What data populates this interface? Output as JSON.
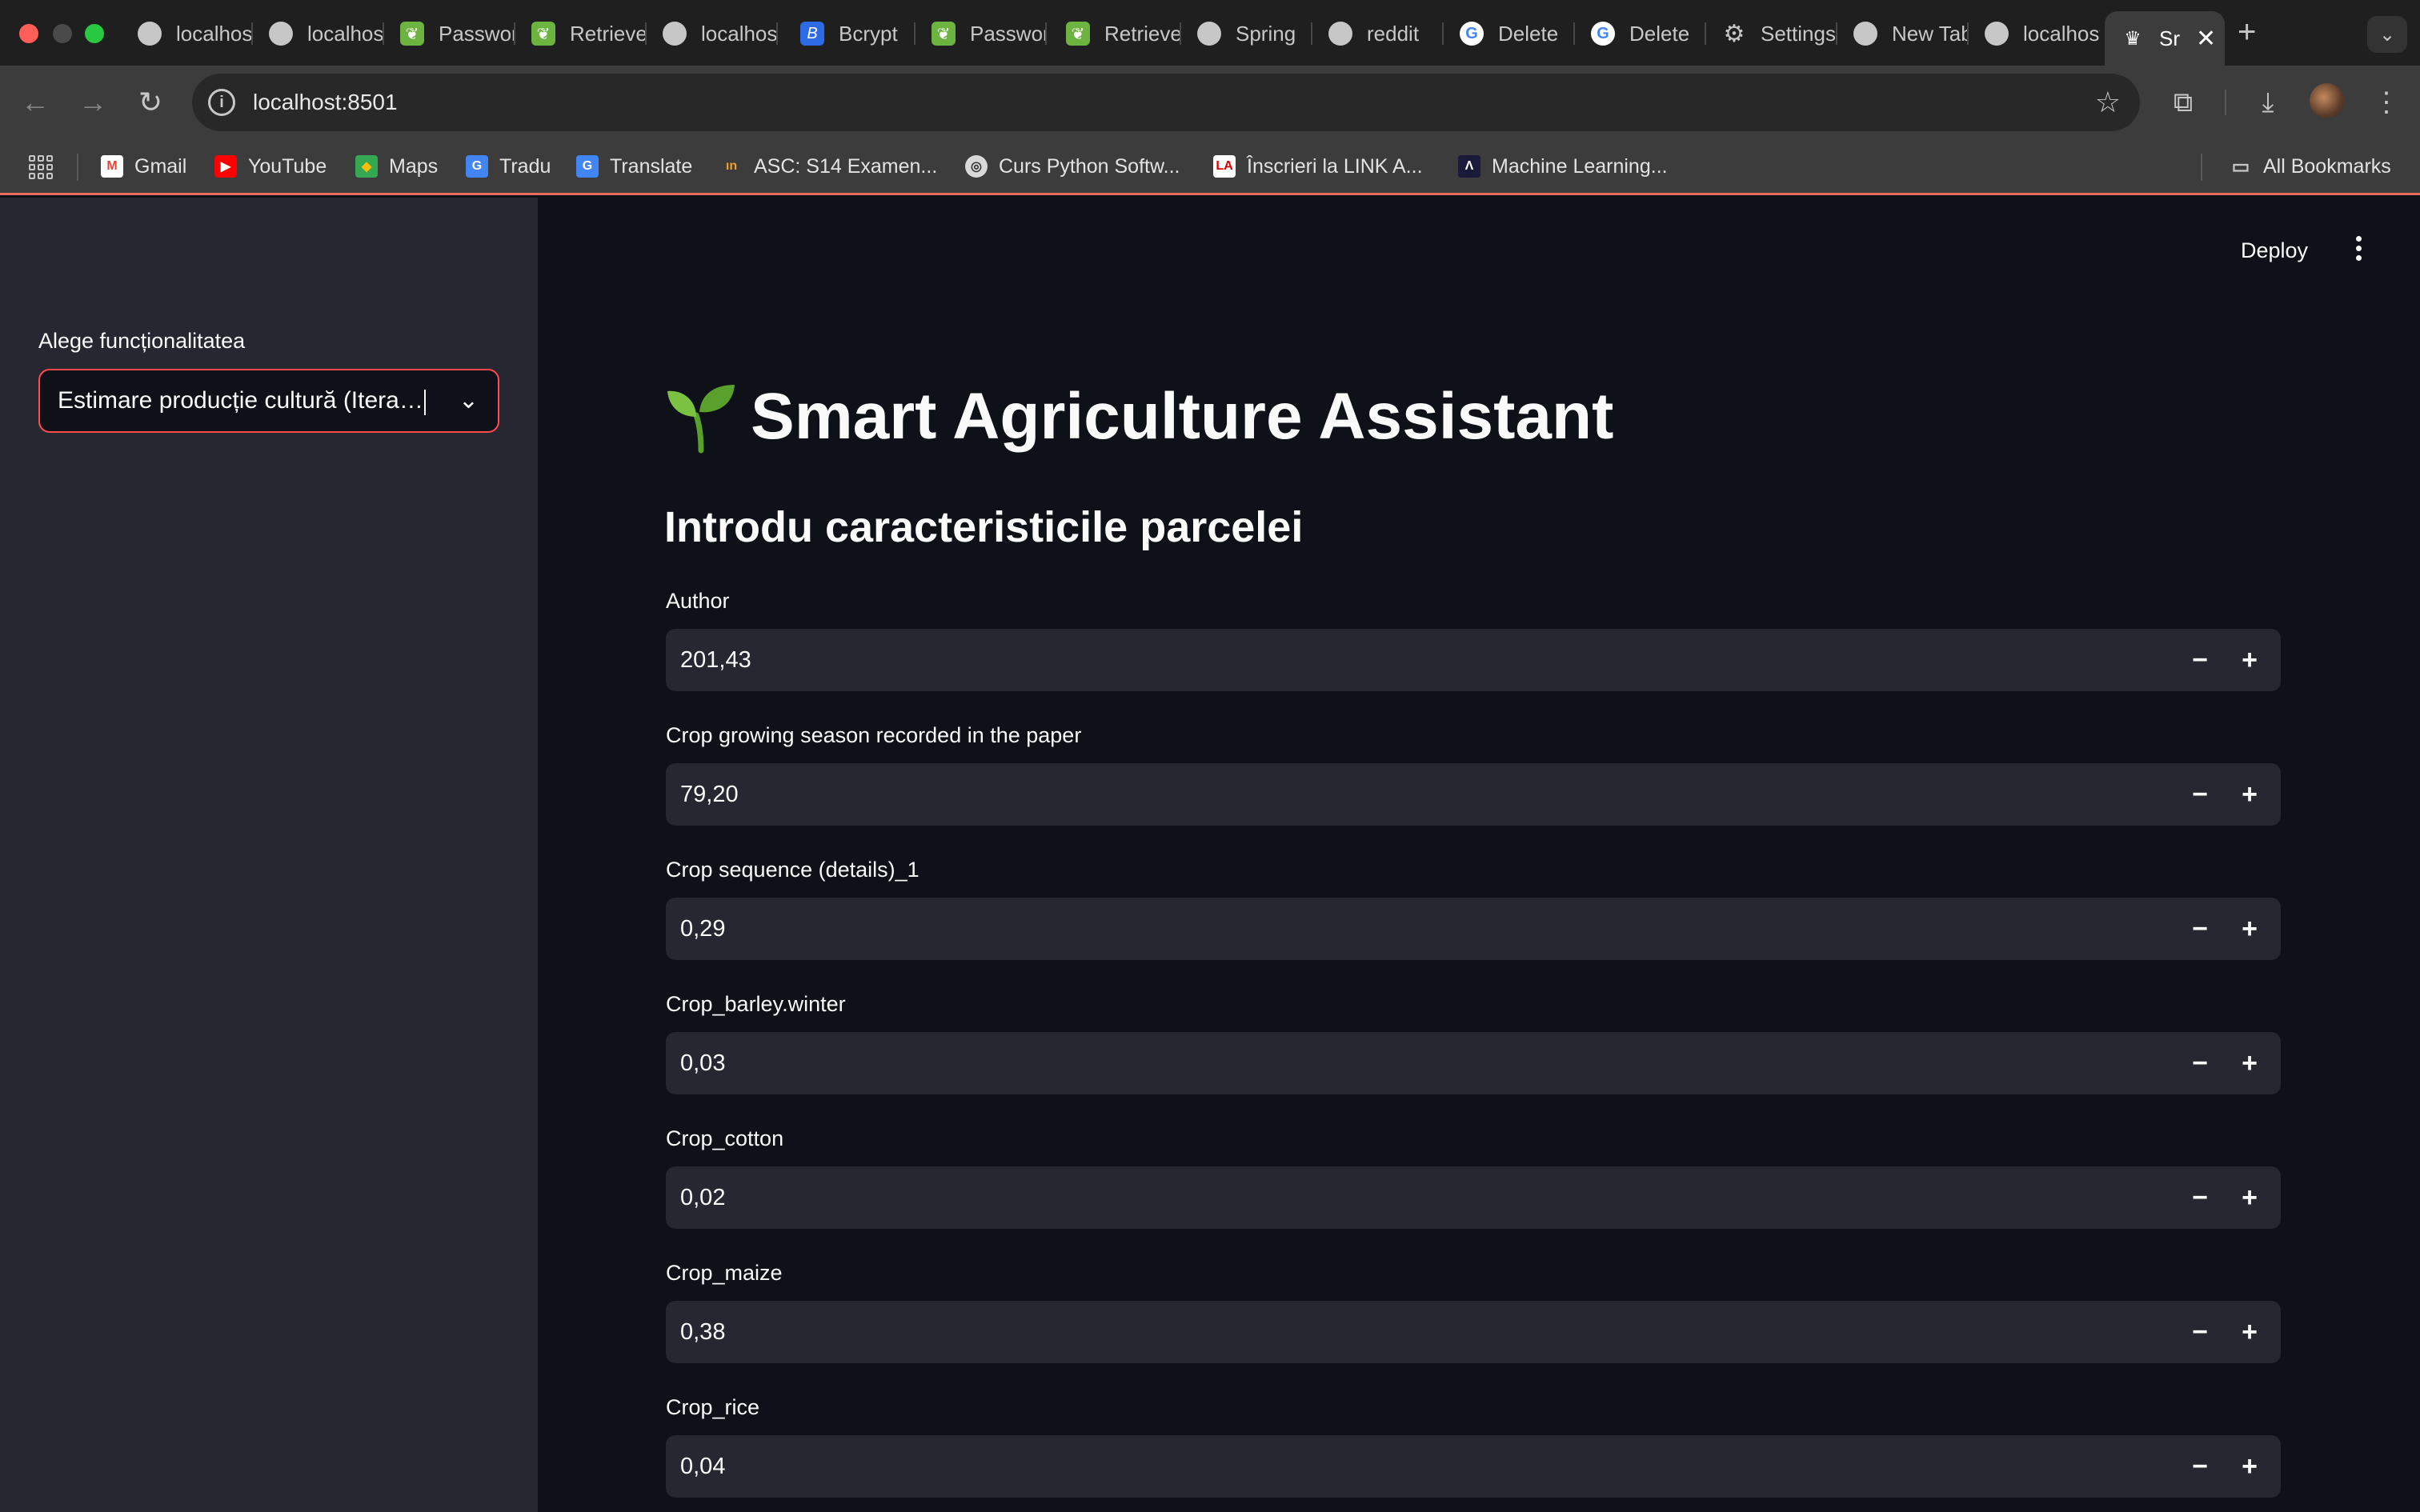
{
  "browser": {
    "tabs": [
      {
        "title": "localhost",
        "icon": "globe-icon"
      },
      {
        "title": "localhost",
        "icon": "globe-icon"
      },
      {
        "title": "Password",
        "icon": "spring-leaf-icon"
      },
      {
        "title": "Retrieve",
        "icon": "spring-leaf-icon"
      },
      {
        "title": "localhost",
        "icon": "globe-icon"
      },
      {
        "title": "Bcrypt",
        "icon": "bcrypt-icon"
      },
      {
        "title": "Password",
        "icon": "spring-leaf-icon"
      },
      {
        "title": "Retrieve",
        "icon": "spring-leaf-icon"
      },
      {
        "title": "Spring",
        "icon": "globe-icon"
      },
      {
        "title": "reddit",
        "icon": "globe-icon"
      },
      {
        "title": "Delete",
        "icon": "google-icon"
      },
      {
        "title": "Delete",
        "icon": "google-icon"
      },
      {
        "title": "Settings",
        "icon": "gear-icon"
      },
      {
        "title": "New Tab",
        "icon": "chrome-icon"
      },
      {
        "title": "localhost",
        "icon": "globe-icon"
      },
      {
        "title": "Sr",
        "icon": "streamlit-crown-icon",
        "active": true
      }
    ],
    "url": "localhost:8501",
    "bookmarks": [
      {
        "label": "Gmail",
        "icon": "gmail-icon"
      },
      {
        "label": "YouTube",
        "icon": "youtube-icon"
      },
      {
        "label": "Maps",
        "icon": "maps-icon"
      },
      {
        "label": "Tradu",
        "icon": "translate-icon"
      },
      {
        "label": "Translate",
        "icon": "translate-icon"
      },
      {
        "label": "ASC: S14 Examen...",
        "icon": "asc-icon"
      },
      {
        "label": "Curs Python Softw...",
        "icon": "python-course-icon"
      },
      {
        "label": "Înscrieri la LINK A...",
        "icon": "link-academy-icon"
      },
      {
        "label": "Machine Learning...",
        "icon": "ml-icon"
      }
    ],
    "all_bookmarks_label": "All Bookmarks"
  },
  "sidebar": {
    "label": "Alege funcționalitatea",
    "selected": "Estimare producție cultură (Itera…"
  },
  "header": {
    "deploy_label": "Deploy"
  },
  "main": {
    "title": "Smart Agriculture Assistant",
    "title_icon": "seedling-icon",
    "subtitle": "Introdu caracteristicile parcelei",
    "fields": [
      {
        "label": "Author",
        "value": "201,43"
      },
      {
        "label": "Crop growing season recorded in the paper",
        "value": "79,20"
      },
      {
        "label": "Crop sequence (details)_1",
        "value": "0,29"
      },
      {
        "label": "Crop_barley.winter",
        "value": "0,03"
      },
      {
        "label": "Crop_cotton",
        "value": "0,02"
      },
      {
        "label": "Crop_maize",
        "value": "0,38"
      },
      {
        "label": "Crop_rice",
        "value": "0,04"
      }
    ],
    "minus_symbol": "−",
    "plus_symbol": "+"
  },
  "colors": {
    "accent": "#ff4b4b",
    "background": "#0e1117",
    "sidebar": "#262730",
    "input": "#262730"
  }
}
